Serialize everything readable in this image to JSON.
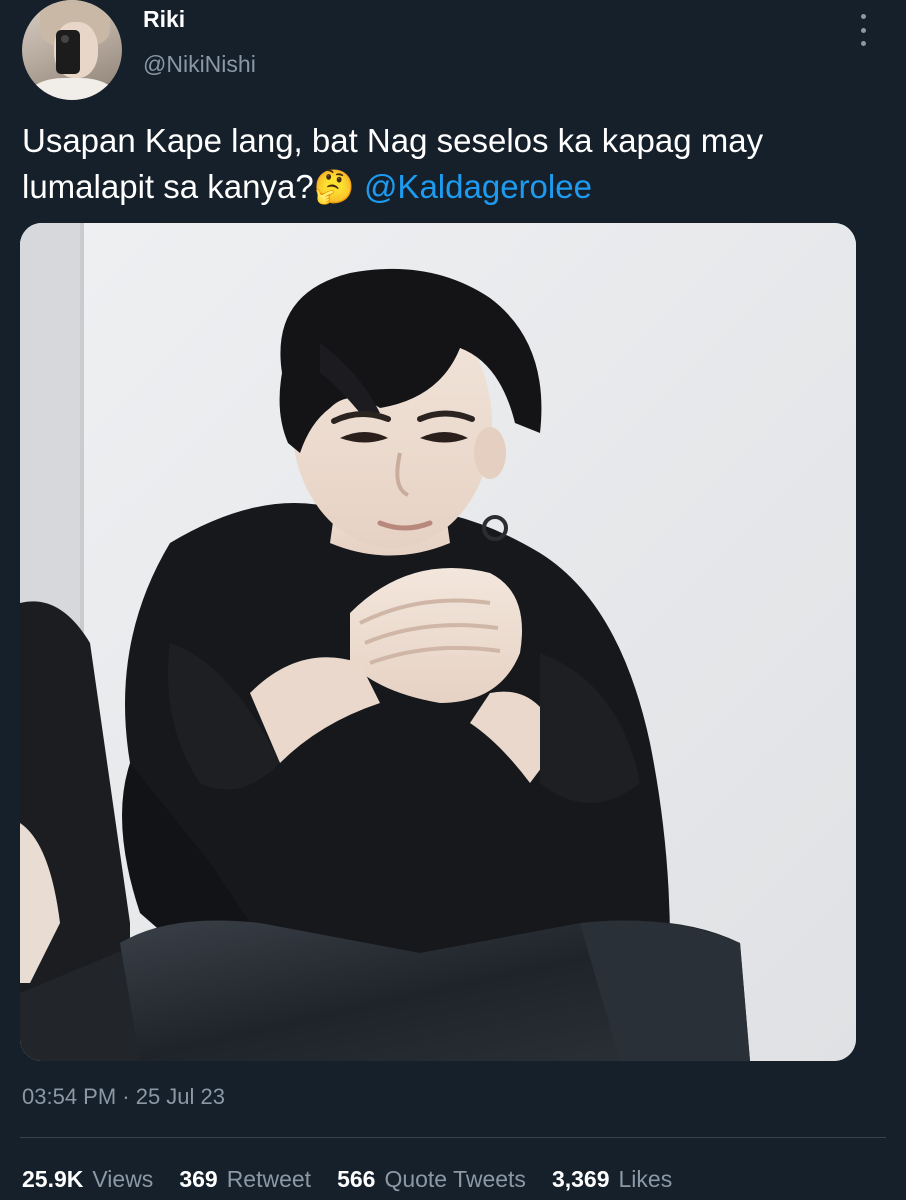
{
  "author": {
    "display_name": "Riki",
    "handle": "@NikiNishi"
  },
  "tweet": {
    "text_main": "Usapan Kape lang, bat Nag seselos ka kapag may lumalapit sa kanya?",
    "emoji": "🤔",
    "mention": "@Kaldagerolee",
    "timestamp": "03:54 PM · 25 Jul 23"
  },
  "stats": [
    {
      "value": "25.9K",
      "label": "Views"
    },
    {
      "value": "369",
      "label": "Retweet"
    },
    {
      "value": "566",
      "label": "Quote Tweets"
    },
    {
      "value": "3,369",
      "label": "Likes"
    }
  ],
  "icons": {
    "more": "more-vertical-icon"
  },
  "colors": {
    "background": "#15202b",
    "text_primary": "#ffffff",
    "text_secondary": "#8b98a5",
    "link": "#1d9bf0",
    "divider": "#38444d"
  }
}
